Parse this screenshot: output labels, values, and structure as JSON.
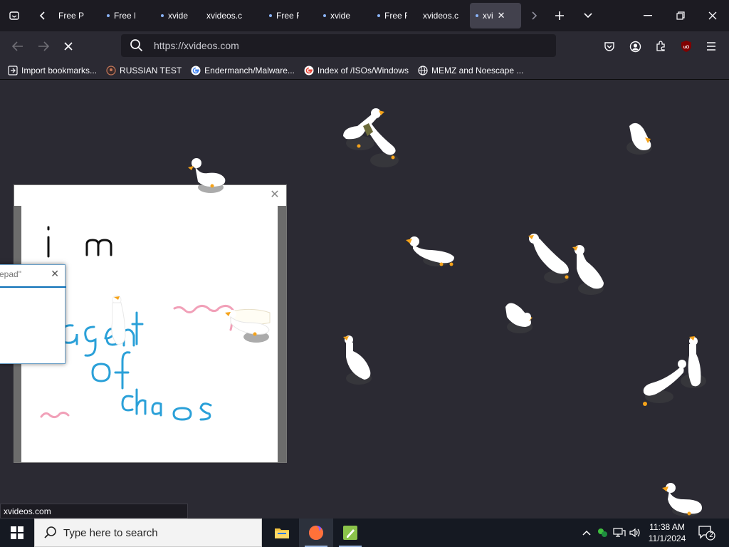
{
  "browser": {
    "tabs": [
      {
        "label": "Free P",
        "dot": false
      },
      {
        "label": "Free P",
        "dot": true
      },
      {
        "label": "xvide",
        "dot": true
      },
      {
        "label": "xvideos.c",
        "dot": false
      },
      {
        "label": "Free F",
        "dot": true
      },
      {
        "label": "xvide",
        "dot": true
      },
      {
        "label": "Free F",
        "dot": true
      },
      {
        "label": "xvideos.c",
        "dot": false
      },
      {
        "label": "xvi",
        "dot": true,
        "active": true
      }
    ],
    "url": "https://xvideos.com",
    "bookmarks": [
      {
        "label": "Import bookmarks...",
        "icon": "import-icon"
      },
      {
        "label": "RUSSIAN TEST",
        "icon": "github-icon"
      },
      {
        "label": "Endermanch/Malware...",
        "icon": "google-icon"
      },
      {
        "label": "Index of /ISOs/Windows",
        "icon": "google-icon"
      },
      {
        "label": "MEMZ and Noescape ...",
        "icon": "globe-icon"
      }
    ],
    "status_url": "xvideos.com",
    "ublock_label": "uO"
  },
  "windows": {
    "notepad_title": "epad\""
  },
  "taskbar": {
    "search_placeholder": "Type here to search",
    "time": "11:38 AM",
    "date": "11/1/2024",
    "notification_count": "2"
  },
  "colors": {
    "tabstrip_bg": "#1c1b22",
    "toolbar_bg": "#2b2a33",
    "urlbar_bg": "#1c1b22",
    "taskbar_bg": "#151922",
    "goose_orange": "#f5a31a",
    "drawing_blue": "#2aa0d8",
    "drawing_pink": "#f1a0b8"
  }
}
